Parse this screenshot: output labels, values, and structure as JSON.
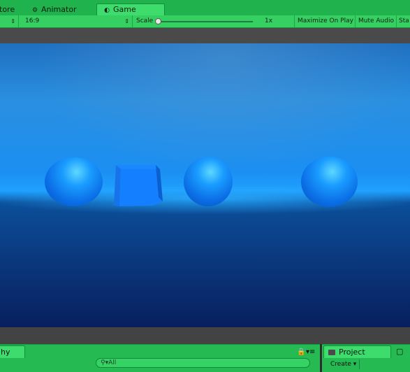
{
  "tabs": {
    "store_label": "tore",
    "animator_label": "Animator",
    "game_label": "Game"
  },
  "game_toolbar": {
    "aspect": "16:9",
    "scale_label": "Scale",
    "scale_value": "1x",
    "scale_fraction": 0.0,
    "maximize_label": "Maximize On Play",
    "mute_label": "Mute Audio",
    "stats_label": "Sta"
  },
  "hierarchy": {
    "tab_label": "hy",
    "search_placeholder": "All"
  },
  "project": {
    "tab_label": "Project",
    "create_label": "Create"
  },
  "colors": {
    "editor_green": "#1fb24d",
    "active_tab": "#3ddc6c",
    "sky_blue": "#1b8ff2",
    "floor_navy": "#081f5c",
    "sphere_blue": "#1a9cff"
  }
}
